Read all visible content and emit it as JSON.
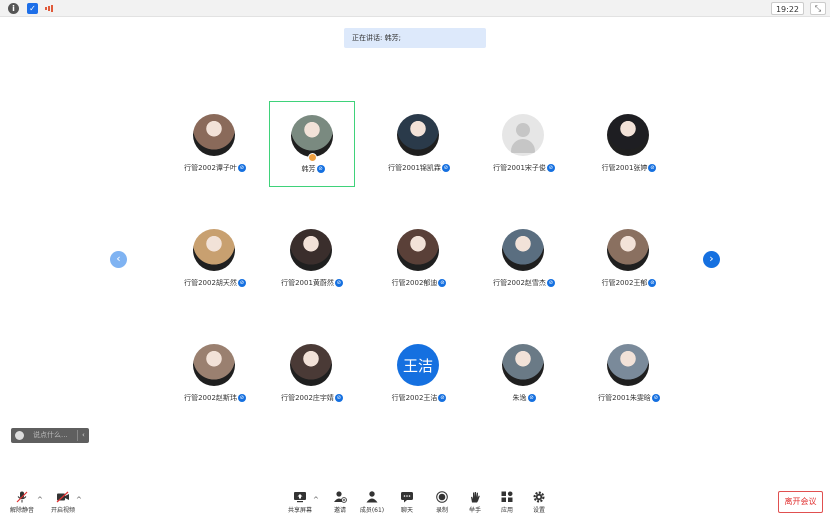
{
  "topbar": {
    "time": "19:22",
    "info_icon": "info-icon",
    "shield_icon": "shield-icon",
    "signal_icon": "signal-icon",
    "expand_icon": "exit-fullscreen-icon"
  },
  "speaking": {
    "text": "正在讲话: 韩芳;"
  },
  "participants": [
    {
      "name": "行管2002谭子叶",
      "avatar": "photo",
      "color": "#8a6a5a",
      "badge": true,
      "active": false
    },
    {
      "name": "韩芳",
      "avatar": "photo",
      "color": "#7a8a80",
      "badge": true,
      "active": true
    },
    {
      "name": "行管2001锦凯霖",
      "avatar": "photo",
      "color": "#2a3a4a",
      "badge": true,
      "active": false
    },
    {
      "name": "行管2001宋子俊",
      "avatar": "default",
      "color": "#e6e6e6",
      "badge": true,
      "active": false
    },
    {
      "name": "行管2001张婷",
      "avatar": "photo",
      "color": "#1e1e22",
      "badge": true,
      "active": false
    },
    {
      "name": "行管2002胡天然",
      "avatar": "photo",
      "color": "#c8a070",
      "badge": true,
      "active": false
    },
    {
      "name": "行管2001黄蔚然",
      "avatar": "photo",
      "color": "#3a2e2c",
      "badge": true,
      "active": false
    },
    {
      "name": "行管2002郁迪",
      "avatar": "photo",
      "color": "#5a4038",
      "badge": true,
      "active": false
    },
    {
      "name": "行管2002赵雪杰",
      "avatar": "photo",
      "color": "#5a6e80",
      "badge": true,
      "active": false
    },
    {
      "name": "行管2002王郁",
      "avatar": "photo",
      "color": "#8a7060",
      "badge": true,
      "active": false
    },
    {
      "name": "行管2002赵斯玮",
      "avatar": "photo",
      "color": "#9a8070",
      "badge": true,
      "active": false
    },
    {
      "name": "行管2002庄宇婧",
      "avatar": "photo",
      "color": "#4a3a36",
      "badge": true,
      "active": false
    },
    {
      "name": "行管2002王洁",
      "avatar": "text",
      "avatar_text": "王洁",
      "color": "#1570e0",
      "badge": true,
      "active": false
    },
    {
      "name": "朱逸",
      "avatar": "photo",
      "color": "#6a7a86",
      "badge": true,
      "active": false
    },
    {
      "name": "行管2001朱雯晗",
      "avatar": "photo",
      "color": "#7a8a9a",
      "badge": true,
      "active": false
    }
  ],
  "nav": {
    "prev_icon": "chevron-left-icon",
    "next_icon": "chevron-right-icon",
    "prev": "‹",
    "next": "›"
  },
  "chat": {
    "placeholder": "说点什么...",
    "arrow": "‹"
  },
  "toolbar": {
    "unmute": "解除静音",
    "start_video": "开启视频",
    "share_screen": "共享屏幕",
    "invite": "邀请",
    "members": "成员(61)",
    "chat": "聊天",
    "record": "录制",
    "raise_hand": "举手",
    "apps": "应用",
    "settings": "设置",
    "leave": "离开会议",
    "caret": "^"
  },
  "colors": {
    "accent": "#1570e0",
    "active_border": "#3fd27a",
    "leave": "#e03030"
  }
}
